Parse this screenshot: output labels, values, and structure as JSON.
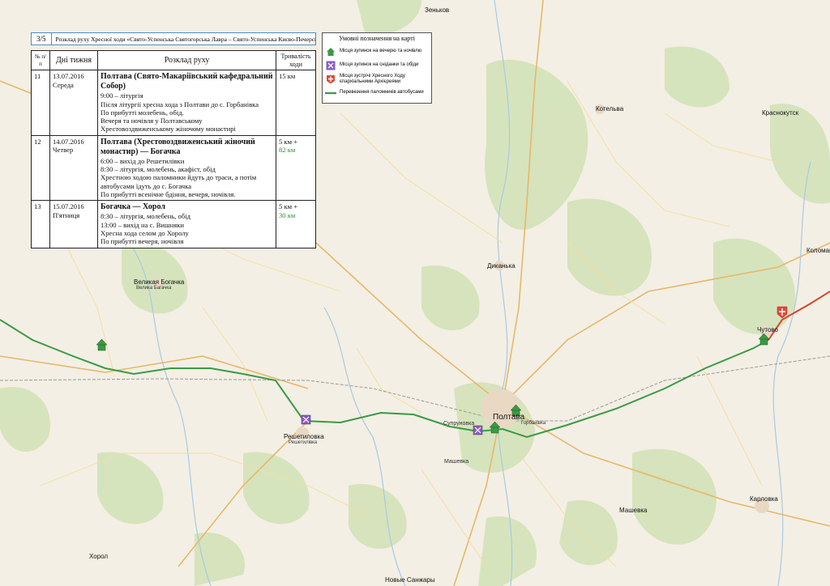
{
  "page": {
    "number": "3/5",
    "title": "Розклад руху Хресної ходи «Свято-Успенська Святогорська Лавра – Свято-Успенська Києво-Печерська Лавра»"
  },
  "table": {
    "headers": [
      "№ п/п",
      "Дні тижня",
      "Розклад руху",
      "Тривалість ходи"
    ],
    "rows": [
      {
        "num": "11",
        "date": "13.07.2016",
        "day": "Середа",
        "route_title": "Полтава (Свято-Макаріївський кафедральний Собор)",
        "lines": [
          "9:00 – літургія",
          "Після літургії хресна хода з Полтави до с. Горбанівка",
          "По прибутті молебень, обід.",
          "Вечеря та ночівля у Полтавському Хрестовоздвиженському жіночому монастирі"
        ],
        "dur": "15 км",
        "dur_extra": ""
      },
      {
        "num": "12",
        "date": "14.07.2016",
        "day": "Четвер",
        "route_title": "Полтава (Хрестовоздвиженський жіночий монастир) — Богачка",
        "lines": [
          "6:00 – вихід до Решетилівки",
          "8:30 – літургія, молебень, акафіст, обід",
          "Хрестною ходою паломники йдуть до траси, а потім автобусами їдуть до с. Богачка",
          "По прибутті всенічне бдіння, вечеря, ночівля."
        ],
        "dur": "5 км +",
        "dur_extra": "82 км"
      },
      {
        "num": "13",
        "date": "15.07.2016",
        "day": "П'ятниця",
        "route_title": "Богачка — Хорол",
        "lines": [
          "8:30 – літургія, молебень, обід",
          "13:00 – вихід на с. Вишняки",
          "Хресна хода селом до Хоролу",
          "По прибутті вечеря, ночівля"
        ],
        "dur": "5 км +",
        "dur_extra": "30 км"
      }
    ]
  },
  "legend": {
    "title": "Умовні позначення на карті",
    "items": [
      {
        "icon": "overnight-house-icon",
        "label": "Місця зупинок на вечерю та ночівлю"
      },
      {
        "icon": "crossed-utensils-icon",
        "label": "Місця зупинок на сніданки та обіди"
      },
      {
        "icon": "cross-shield-icon",
        "label": "Місця зустрічі Хресного Ходу єпархіальними Архієреями"
      },
      {
        "icon": "bus-route-line-icon",
        "label": "Перевезення паломників автобусами"
      }
    ]
  },
  "colors": {
    "route_walk": "#3a9a44",
    "route_other": "#d9432b",
    "table_border": "#222222",
    "title_border": "#4a90c0"
  },
  "map_labels": [
    {
      "text": "Великая Богачка"
    },
    {
      "text": "Велика Багачка"
    },
    {
      "text": "Решетиловка"
    },
    {
      "text": "Решетилівка"
    },
    {
      "text": "Полтава"
    },
    {
      "text": "Диканька"
    },
    {
      "text": "Котельва"
    },
    {
      "text": "Чутово"
    },
    {
      "text": "Карловка"
    },
    {
      "text": "Машевка"
    },
    {
      "text": "Хорол"
    },
    {
      "text": "Новые Санжары"
    },
    {
      "text": "Зеньков"
    },
    {
      "text": "Краснокутск"
    },
    {
      "text": "Коломак"
    },
    {
      "text": "Супруновка"
    },
    {
      "text": "Машевка"
    },
    {
      "text": "Горбанівка"
    }
  ]
}
